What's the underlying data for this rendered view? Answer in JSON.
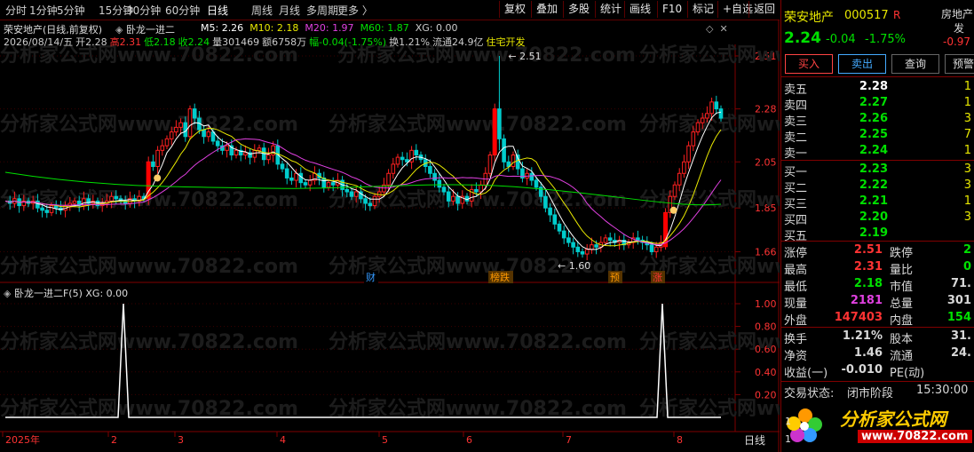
{
  "toolbar": {
    "periods": [
      "分时",
      "1分钟",
      "5分钟",
      "15分钟",
      "30分钟",
      "60分钟",
      "日线",
      "周线",
      "月线",
      "多周期",
      "更多 〉"
    ],
    "active_period": "日线",
    "buttons": [
      "复权",
      "叠加",
      "多股",
      "统计",
      "画线",
      "F10",
      "标记",
      "+自选",
      "返回"
    ]
  },
  "chart": {
    "line1_title": "荣安地产(日线,前复权)",
    "indicator_name": "卧龙一进二",
    "ma_labels": [
      {
        "text": "M5: 2.26",
        "color": "#ffffff"
      },
      {
        "text": "M10: 2.18",
        "color": "#e8e800"
      },
      {
        "text": "M20: 1.97",
        "color": "#e040e0"
      },
      {
        "text": "M60: 1.87",
        "color": "#00e000"
      },
      {
        "text": "XG: 0.00",
        "color": "#cccccc"
      }
    ],
    "line2": [
      {
        "text": "2026/08/14/五",
        "color": "#cccccc"
      },
      {
        "text": "开2.28",
        "color": "#cccccc"
      },
      {
        "text": "高2.31",
        "color": "#ff3333"
      },
      {
        "text": "低2.18",
        "color": "#00e000"
      },
      {
        "text": "收2.24",
        "color": "#00e000"
      },
      {
        "text": "量301469",
        "color": "#cccccc"
      },
      {
        "text": "额6758万",
        "color": "#cccccc"
      },
      {
        "text": "幅-0.04(-1.75%)",
        "color": "#00e000"
      },
      {
        "text": "换1.21%",
        "color": "#cccccc"
      },
      {
        "text": "流通24.9亿",
        "color": "#cccccc"
      },
      {
        "text": "住宅开发",
        "color": "#e8e800"
      }
    ],
    "price_ticks": [
      "2.51",
      "2.28",
      "2.05",
      "1.85",
      "1.66"
    ],
    "high_marker": "2.51",
    "low_marker": "1.60",
    "event_tags": [
      {
        "text": "财",
        "color": "#3399ff"
      },
      {
        "text": "榜跌",
        "color": "#ff9900"
      },
      {
        "text": "预",
        "color": "#ff9900"
      },
      {
        "text": "涨",
        "color": "#ff3333"
      }
    ],
    "sub_title": "卧龙一进二F(5)",
    "sub_value": "XG: 0.00",
    "sub_ticks": [
      "1.00",
      "0.80",
      "0.60",
      "0.40",
      "0.20"
    ],
    "x_labels": [
      "2025年",
      "2",
      "3",
      "4",
      "5",
      "6",
      "7",
      "8"
    ],
    "period_label": "日线",
    "watermark": "分析家公式网www.70822.com"
  },
  "panel": {
    "stock_name": "荣安地产",
    "stock_code": "000517",
    "r_badge": "R",
    "sector": "房地产",
    "sector_sub": "发",
    "price": "2.24",
    "change": "-0.04",
    "change_pct": "-1.75%",
    "side_change": "-0.97",
    "buy_label": "买入",
    "sell_label": "卖出",
    "query_label": "查询",
    "warn_label": "预警",
    "asks": [
      {
        "label": "卖五",
        "price": "2.28",
        "vol": "1",
        "color": "#ffffff"
      },
      {
        "label": "卖四",
        "price": "2.27",
        "vol": "1",
        "color": "#00e000"
      },
      {
        "label": "卖三",
        "price": "2.26",
        "vol": "3",
        "color": "#00e000"
      },
      {
        "label": "卖二",
        "price": "2.25",
        "vol": "7",
        "color": "#00e000"
      },
      {
        "label": "卖一",
        "price": "2.24",
        "vol": "1",
        "color": "#00e000"
      }
    ],
    "bids": [
      {
        "label": "买一",
        "price": "2.23",
        "vol": "3",
        "color": "#00e000"
      },
      {
        "label": "买二",
        "price": "2.22",
        "vol": "3",
        "color": "#00e000"
      },
      {
        "label": "买三",
        "price": "2.21",
        "vol": "1",
        "color": "#00e000"
      },
      {
        "label": "买四",
        "price": "2.20",
        "vol": "3",
        "color": "#00e000"
      },
      {
        "label": "买五",
        "price": "2.19",
        "vol": "",
        "color": "#00e000"
      }
    ],
    "stats1": [
      {
        "k": "涨停",
        "v": "2.51",
        "vc": "#ff3333",
        "k2": "跌停",
        "v2": "2",
        "v2c": "#00e000"
      },
      {
        "k": "最高",
        "v": "2.31",
        "vc": "#ff3333",
        "k2": "量比",
        "v2": "0",
        "v2c": "#00e000"
      },
      {
        "k": "最低",
        "v": "2.18",
        "vc": "#00e000",
        "k2": "市值",
        "v2": "71.",
        "v2c": "#d8d8d8"
      },
      {
        "k": "现量",
        "v": "2181",
        "vc": "#e040e0",
        "k2": "总量",
        "v2": "301",
        "v2c": "#d8d8d8"
      },
      {
        "k": "外盘",
        "v": "147403",
        "vc": "#ff3333",
        "k2": "内盘",
        "v2": "154",
        "v2c": "#00e000"
      }
    ],
    "stats2": [
      {
        "k": "换手",
        "v": "1.21%",
        "vc": "#d8d8d8",
        "k2": "股本",
        "v2": "31.",
        "v2c": "#d8d8d8"
      },
      {
        "k": "净资",
        "v": "1.46",
        "vc": "#d8d8d8",
        "k2": "流通",
        "v2": "24.",
        "v2c": "#d8d8d8"
      },
      {
        "k": "收益(一)",
        "v": "-0.010",
        "vc": "#d8d8d8",
        "k2": "PE(动)",
        "v2": "",
        "v2c": "#d8d8d8"
      }
    ],
    "trade_status_label": "交易状态:",
    "trade_status": "闭市阶段",
    "trade_time": "15:30:00",
    "logo_text": "分析家公式网",
    "logo_url": "www.70822.com",
    "bottom_nums": [
      "1",
      "1"
    ]
  }
}
